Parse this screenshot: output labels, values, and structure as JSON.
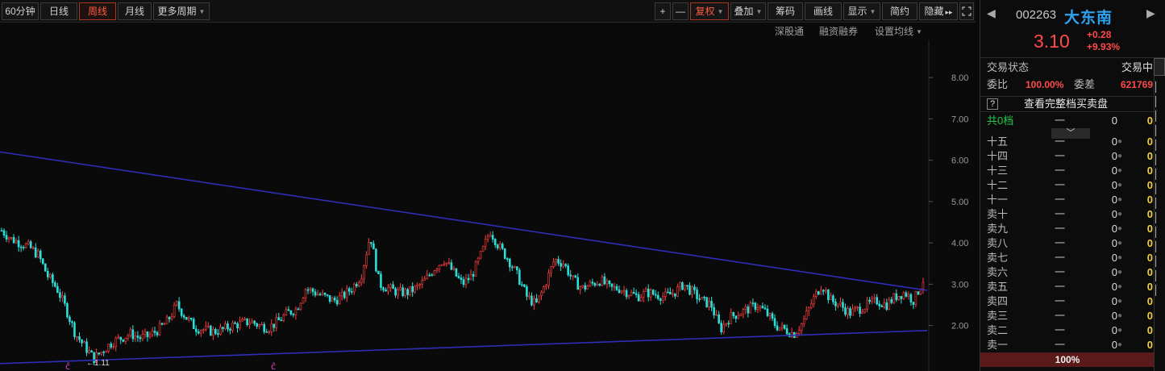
{
  "toolbar": {
    "period_60min": "60分钟",
    "period_day": "日线",
    "period_week": "周线",
    "period_month": "月线",
    "period_more": "更多周期",
    "zoom_in": "+",
    "zoom_out": "—",
    "adjust": "复权",
    "overlay": "叠加",
    "chips": "筹码",
    "draw": "画线",
    "display": "显示",
    "simple": "简约",
    "hide": "隐藏",
    "expand_arrow": "▸▸"
  },
  "subtoolbar": {
    "shenzhen_connect": "深股通",
    "margin_trading": "融资融券",
    "set_ma": "设置均线"
  },
  "stock": {
    "code": "002263",
    "name": "大东南",
    "price": "3.10",
    "change": "+0.28",
    "change_pct": "+9.93%"
  },
  "orderbook": {
    "status_label": "交易状态",
    "status_value": "交易中",
    "ratio_label": "委比",
    "ratio_value": "100.00%",
    "diff_label": "委差",
    "diff_value": "621769",
    "help": "?",
    "full_book": "查看完整档买卖盘",
    "total_label": "共0档",
    "dash": "一",
    "zero": "0",
    "expand": "﹀",
    "asks": [
      {
        "label": "十五"
      },
      {
        "label": "十四"
      },
      {
        "label": "十三"
      },
      {
        "label": "十二"
      },
      {
        "label": "十一"
      },
      {
        "label": "卖十"
      },
      {
        "label": "卖九"
      },
      {
        "label": "卖八"
      },
      {
        "label": "卖七"
      },
      {
        "label": "卖六"
      },
      {
        "label": "卖五"
      },
      {
        "label": "卖四"
      },
      {
        "label": "卖三"
      },
      {
        "label": "卖二"
      },
      {
        "label": "卖一"
      }
    ],
    "pct_bar": "100%"
  },
  "colors": {
    "up": "#ff3d3d",
    "down": "#2adfd8",
    "trend": "#2e2eb8",
    "marker": "#e040c0",
    "background": "#0a0a0a"
  },
  "chart_data": {
    "type": "candlestick",
    "y_ticks": [
      "8.00",
      "7.00",
      "6.00",
      "5.00",
      "4.00",
      "3.00",
      "2.00"
    ],
    "ylim": [
      0.9,
      8.9
    ],
    "grid": false,
    "low_annotation": "←1.11",
    "low_value": 1.11,
    "marker_glyph": "ĉ",
    "trendline_upper": [
      [
        0,
        6.2
      ],
      [
        1150,
        2.85
      ]
    ],
    "trendline_lower": [
      [
        0,
        1.08
      ],
      [
        1150,
        1.88
      ]
    ],
    "closes": [
      4.3,
      4.1,
      4.0,
      3.9,
      3.7,
      3.2,
      2.9,
      2.4,
      1.8,
      1.5,
      1.2,
      1.4,
      1.6,
      1.7,
      1.8,
      1.7,
      1.75,
      1.9,
      2.1,
      2.5,
      2.2,
      1.95,
      1.9,
      1.85,
      1.9,
      2.0,
      2.05,
      2.1,
      2.0,
      1.95,
      2.1,
      2.3,
      2.4,
      2.9,
      2.8,
      2.7,
      2.6,
      2.7,
      2.9,
      3.2,
      4.2,
      3.0,
      2.9,
      2.8,
      2.8,
      2.9,
      3.1,
      3.4,
      3.6,
      3.3,
      3.0,
      3.2,
      3.7,
      4.3,
      3.9,
      3.6,
      3.2,
      2.7,
      2.5,
      3.0,
      3.6,
      3.5,
      3.1,
      2.9,
      3.0,
      3.1,
      2.9,
      2.9,
      2.8,
      2.7,
      2.8,
      2.75,
      2.7,
      2.8,
      3.0,
      2.8,
      2.6,
      2.5,
      1.9,
      2.2,
      2.3,
      2.4,
      2.5,
      2.3,
      2.0,
      1.9,
      1.8,
      2.1,
      2.6,
      3.0,
      2.6,
      2.5,
      2.3,
      2.4,
      2.5,
      2.6,
      2.5,
      2.7,
      2.8,
      2.6,
      3.1
    ]
  }
}
